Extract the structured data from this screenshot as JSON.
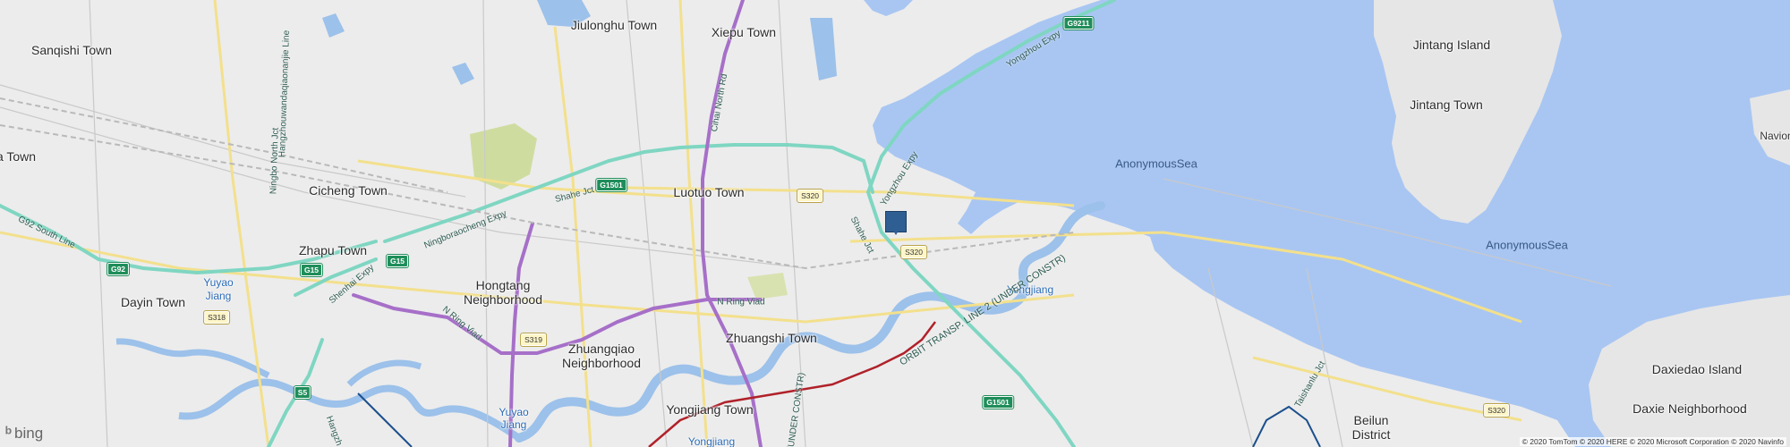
{
  "colors": {
    "land": "#ececec",
    "sea": "#a9c6f2",
    "island": "#e6e6e6",
    "expressway": "#7fd6c2",
    "major_road": "#f3e08c",
    "ring_road": "#a66fc8",
    "metro_red": "#b0212a",
    "metro_blue": "#1b4f8c",
    "river": "#9cc1ea",
    "park": "#cfdca0",
    "marker": "#2f5e93"
  },
  "places": {
    "sanqishi": "Sanqishi Town",
    "jiulonghu": "Jiulonghu Town",
    "xiepu": "Xiepu Town",
    "cicheng": "Cicheng Town",
    "luotuo": "Luotuo Town",
    "zhapu": "Zhapu Town",
    "dayin": "Dayin Town",
    "yuyao_jiang_1": "Yuyao Jiang",
    "hongtang": "Hongtang Neighborhood",
    "zhuangqiao": "Zhuangqiao Neighborhood",
    "zhuangshi": "Zhuangshi Town",
    "yongjiang_town": "Yongjiang Town",
    "yongjiang_water": "Yongjiang",
    "yuyao_jiang_2": "Yuyao Jiang",
    "yongjiang_bottom": "Yongjiang",
    "jintang_island": "Jintang Island",
    "jintang_town": "Jintang Town",
    "anonymous_sea_1": "AnonymousSea",
    "anonymous_sea_2": "AnonymousSea",
    "daxiedao": "Daxiedao Island",
    "daxie_nb": "Daxie Neighborhood",
    "beilun_1": "Beilun",
    "beilun_2": "District",
    "left_town": "a Town",
    "navion": "Navion"
  },
  "roads": {
    "hangzhouwan": "Hangzhouwandaqiaonanjie Line",
    "ningbo_north_jct": "Ningbo North Jct",
    "cihai_north": "Cihai North Rd",
    "yongzhou_expy_top": "Yongzhou Expy",
    "yongzhou_expy_mid": "Yongzhou Expy",
    "shahe_jct_1": "Shahe Jct",
    "shahe_jct_2": "Shahe Jct",
    "ningboraocheng": "Ningboraocheng Expy",
    "g92_south": "G92 South Line",
    "shenhai": "Shenhai Expy",
    "n_ring_1": "N Ring Viad",
    "n_ring_2": "N Ring Viad",
    "orbit_line2": "ORBIT TRANSP. LINE 2 (UNDER CONSTR)",
    "under_constr": "(UNDER CONSTR)",
    "taishanlu": "Taishanlu Jct",
    "hangzhou_bottom": "Hangzh"
  },
  "shields": {
    "g9211": "G9211",
    "g1501_a": "G1501",
    "s320_a": "S320",
    "s320_b": "S320",
    "g92": "G92",
    "g15_a": "G15",
    "g15_b": "G15",
    "s318": "S318",
    "s319": "S319",
    "s5": "S5",
    "g1501_b": "G1501",
    "s320_c": "S320"
  },
  "attribution": {
    "logo_text": "bing",
    "copyright": "© 2020 TomTom © 2020 HERE © 2020 Microsoft Corporation © 2020 Navinfo"
  }
}
